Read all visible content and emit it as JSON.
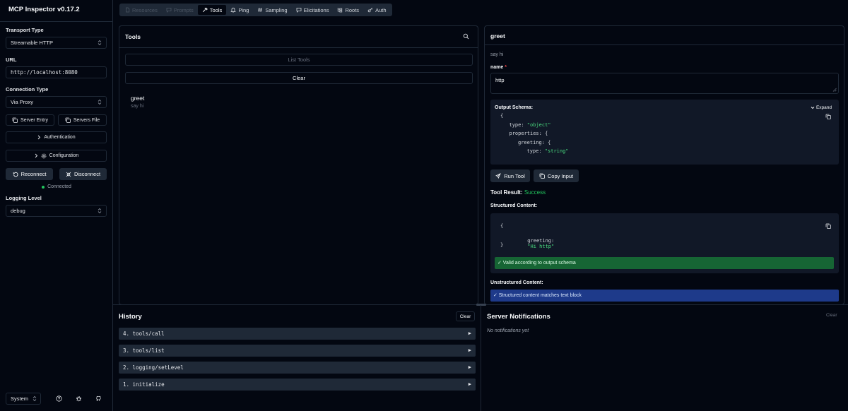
{
  "app": {
    "title": "MCP Inspector v0.17.2"
  },
  "sidebar": {
    "transport_label": "Transport Type",
    "transport_value": "Streamable HTTP",
    "url_label": "URL",
    "url_value": "http://localhost:8080",
    "connection_label": "Connection Type",
    "connection_value": "Via Proxy",
    "server_entry_label": "Server Entry",
    "servers_file_label": "Servers File",
    "authentication_label": "Authentication",
    "configuration_label": "Configuration",
    "reconnect_label": "Reconnect",
    "disconnect_label": "Disconnect",
    "status_text": "Connected",
    "logging_label": "Logging Level",
    "logging_value": "debug",
    "theme_value": "System"
  },
  "tabs": [
    {
      "label": "Resources",
      "icon": "files-icon",
      "state": "disabled"
    },
    {
      "label": "Prompts",
      "icon": "message-icon",
      "state": "disabled"
    },
    {
      "label": "Tools",
      "icon": "hammer-icon",
      "state": "active"
    },
    {
      "label": "Ping",
      "icon": "bell-icon",
      "state": "normal"
    },
    {
      "label": "Sampling",
      "icon": "hash-icon",
      "state": "normal"
    },
    {
      "label": "Elicitations",
      "icon": "message-square-icon",
      "state": "normal"
    },
    {
      "label": "Roots",
      "icon": "folder-tree-icon",
      "state": "normal"
    },
    {
      "label": "Auth",
      "icon": "key-icon",
      "state": "normal"
    }
  ],
  "tools_panel": {
    "title": "Tools",
    "list_tools_label": "List Tools",
    "clear_label": "Clear",
    "items": [
      {
        "name": "greet",
        "description": "say hi"
      }
    ]
  },
  "tool_detail": {
    "title": "greet",
    "description": "say hi",
    "param_label": "name",
    "param_required_mark": "*",
    "param_value": "http",
    "output_schema_label": "Output Schema:",
    "expand_label": "Expand",
    "schema_lines": [
      {
        "indent": 0,
        "text": "{",
        "key": "",
        "value": ""
      },
      {
        "indent": 1,
        "text": "",
        "key": "type:",
        "value": "\"object\""
      },
      {
        "indent": 1,
        "text": "",
        "key": "properties:",
        "value": "{"
      },
      {
        "indent": 2,
        "text": "",
        "key": "greeting:",
        "value": "{"
      },
      {
        "indent": 3,
        "text": "",
        "key": "type:",
        "value": "\"string\""
      }
    ],
    "run_tool_label": "Run Tool",
    "copy_input_label": "Copy Input",
    "result_label": "Tool Result:",
    "result_status": "Success",
    "structured_label": "Structured Content:",
    "structured_open": "{",
    "structured_key": "greeting:",
    "structured_value": "\"Hi http\"",
    "structured_close": "}",
    "valid_text": "✓ Valid according to output schema",
    "unstructured_label": "Unstructured Content:",
    "match_text": "✓ Structured content matches text block"
  },
  "history": {
    "title": "History",
    "clear_label": "Clear",
    "items": [
      "4. tools/call",
      "3. tools/list",
      "2. logging/setLevel",
      "1. initialize"
    ]
  },
  "notifications": {
    "title": "Server Notifications",
    "clear_label": "Clear",
    "empty_text": "No notifications yet"
  },
  "colors": {
    "background": "#030711",
    "border": "#1f2937",
    "success": "#22c55e",
    "valid_banner": "#166534",
    "match_banner": "#1e3a8a",
    "string_literal": "#4ade80"
  }
}
